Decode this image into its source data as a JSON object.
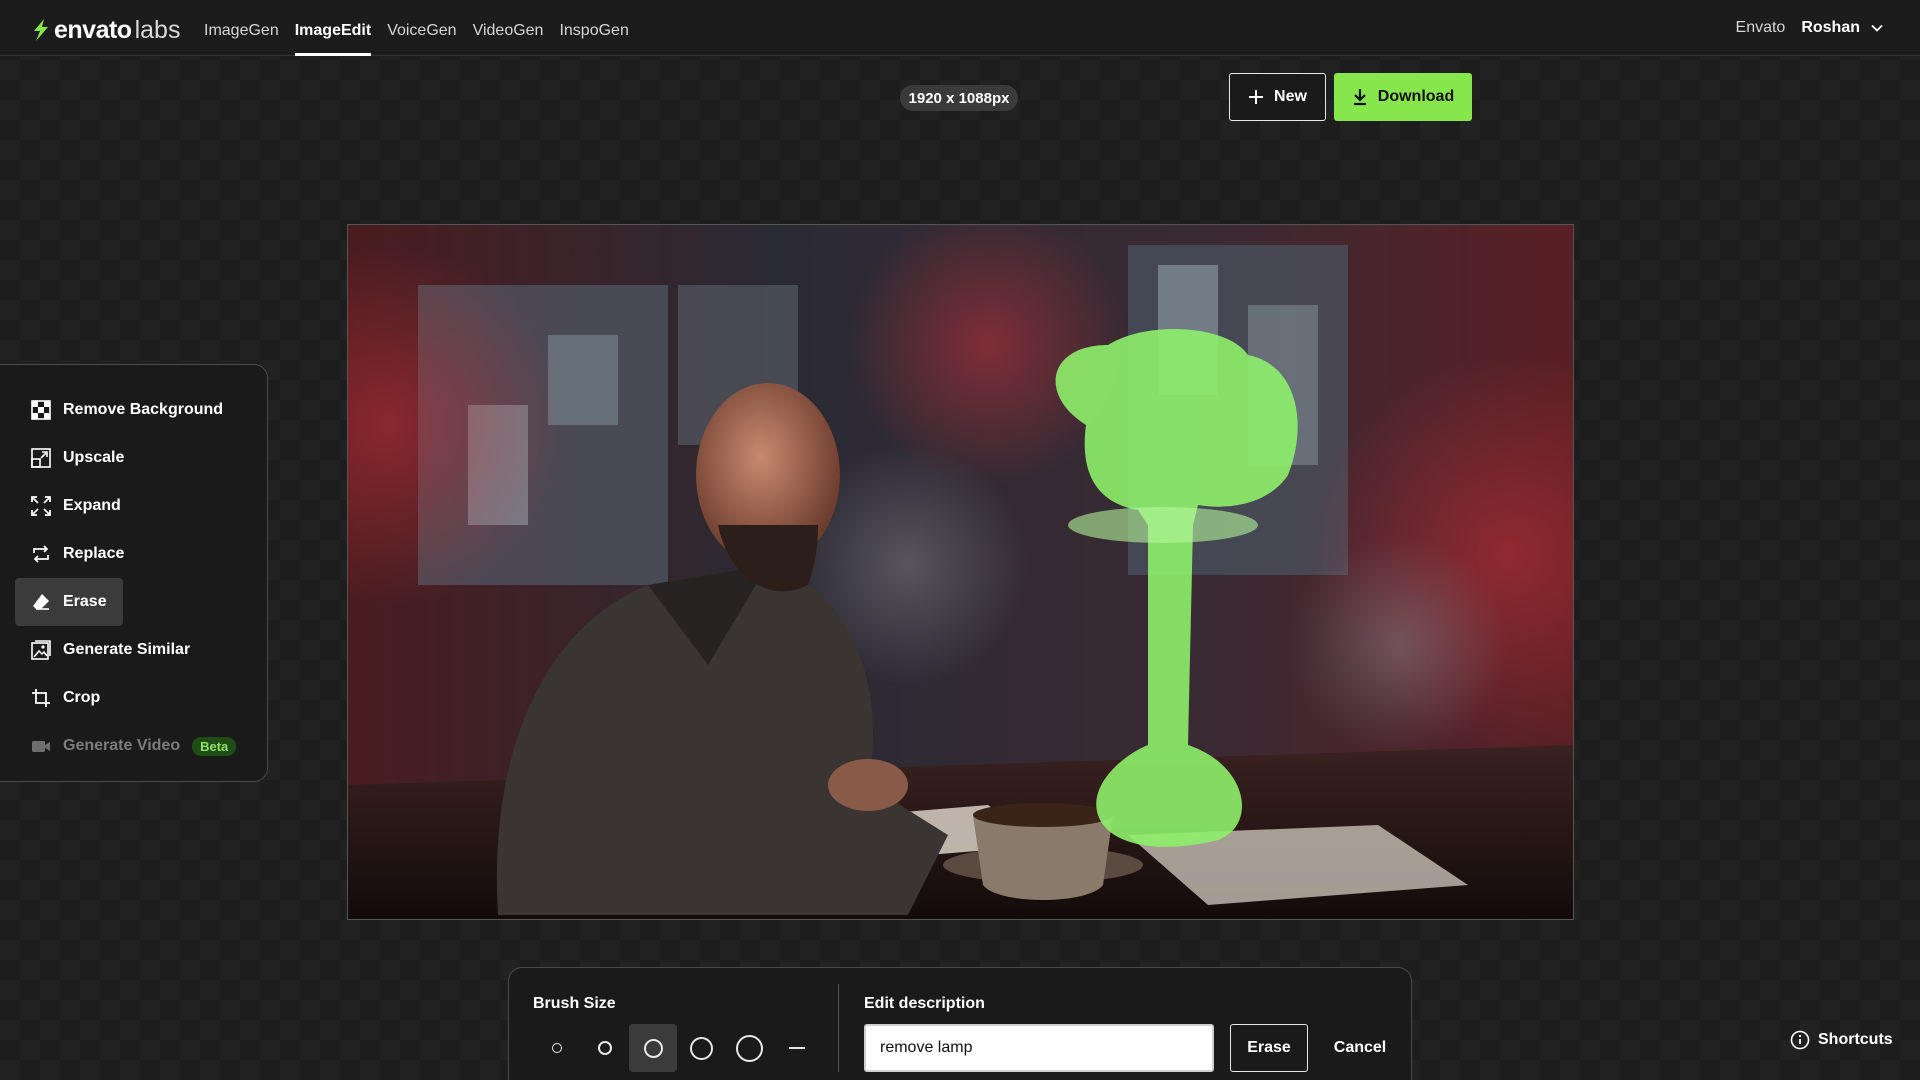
{
  "header": {
    "brand": "envato",
    "brand_suffix": "labs",
    "nav": [
      {
        "label": "ImageGen"
      },
      {
        "label": "ImageEdit",
        "active": true
      },
      {
        "label": "VoiceGen"
      },
      {
        "label": "VideoGen"
      },
      {
        "label": "InspoGen"
      }
    ],
    "envato_link": "Envato",
    "user_name": "Roshan"
  },
  "toolbar": {
    "dimensions": "1920 x 1088px",
    "new_label": "New",
    "download_label": "Download"
  },
  "tools": {
    "items": [
      {
        "label": "Remove Background",
        "icon": "checkerboard-icon"
      },
      {
        "label": "Upscale",
        "icon": "upscale-icon"
      },
      {
        "label": "Expand",
        "icon": "expand-icon"
      },
      {
        "label": "Replace",
        "icon": "replace-icon"
      },
      {
        "label": "Erase",
        "icon": "eraser-icon",
        "active": true
      },
      {
        "label": "Generate Similar",
        "icon": "image-icon"
      },
      {
        "label": "Crop",
        "icon": "crop-icon"
      },
      {
        "label": "Generate Video",
        "icon": "video-icon",
        "disabled": true
      }
    ],
    "beta_label": "Beta"
  },
  "brush_panel": {
    "brush_size_label": "Brush Size",
    "brush_sizes": [
      "xs",
      "s",
      "m",
      "l",
      "xl",
      "clear"
    ],
    "selected_brush_size": "m",
    "edit_description_label": "Edit description",
    "edit_description_value": "remove lamp",
    "erase_label": "Erase",
    "cancel_label": "Cancel"
  },
  "shortcuts_label": "Shortcuts",
  "colors": {
    "accent": "#87e64b",
    "mask": "#8ef06a",
    "background": "#1d1d1d"
  }
}
